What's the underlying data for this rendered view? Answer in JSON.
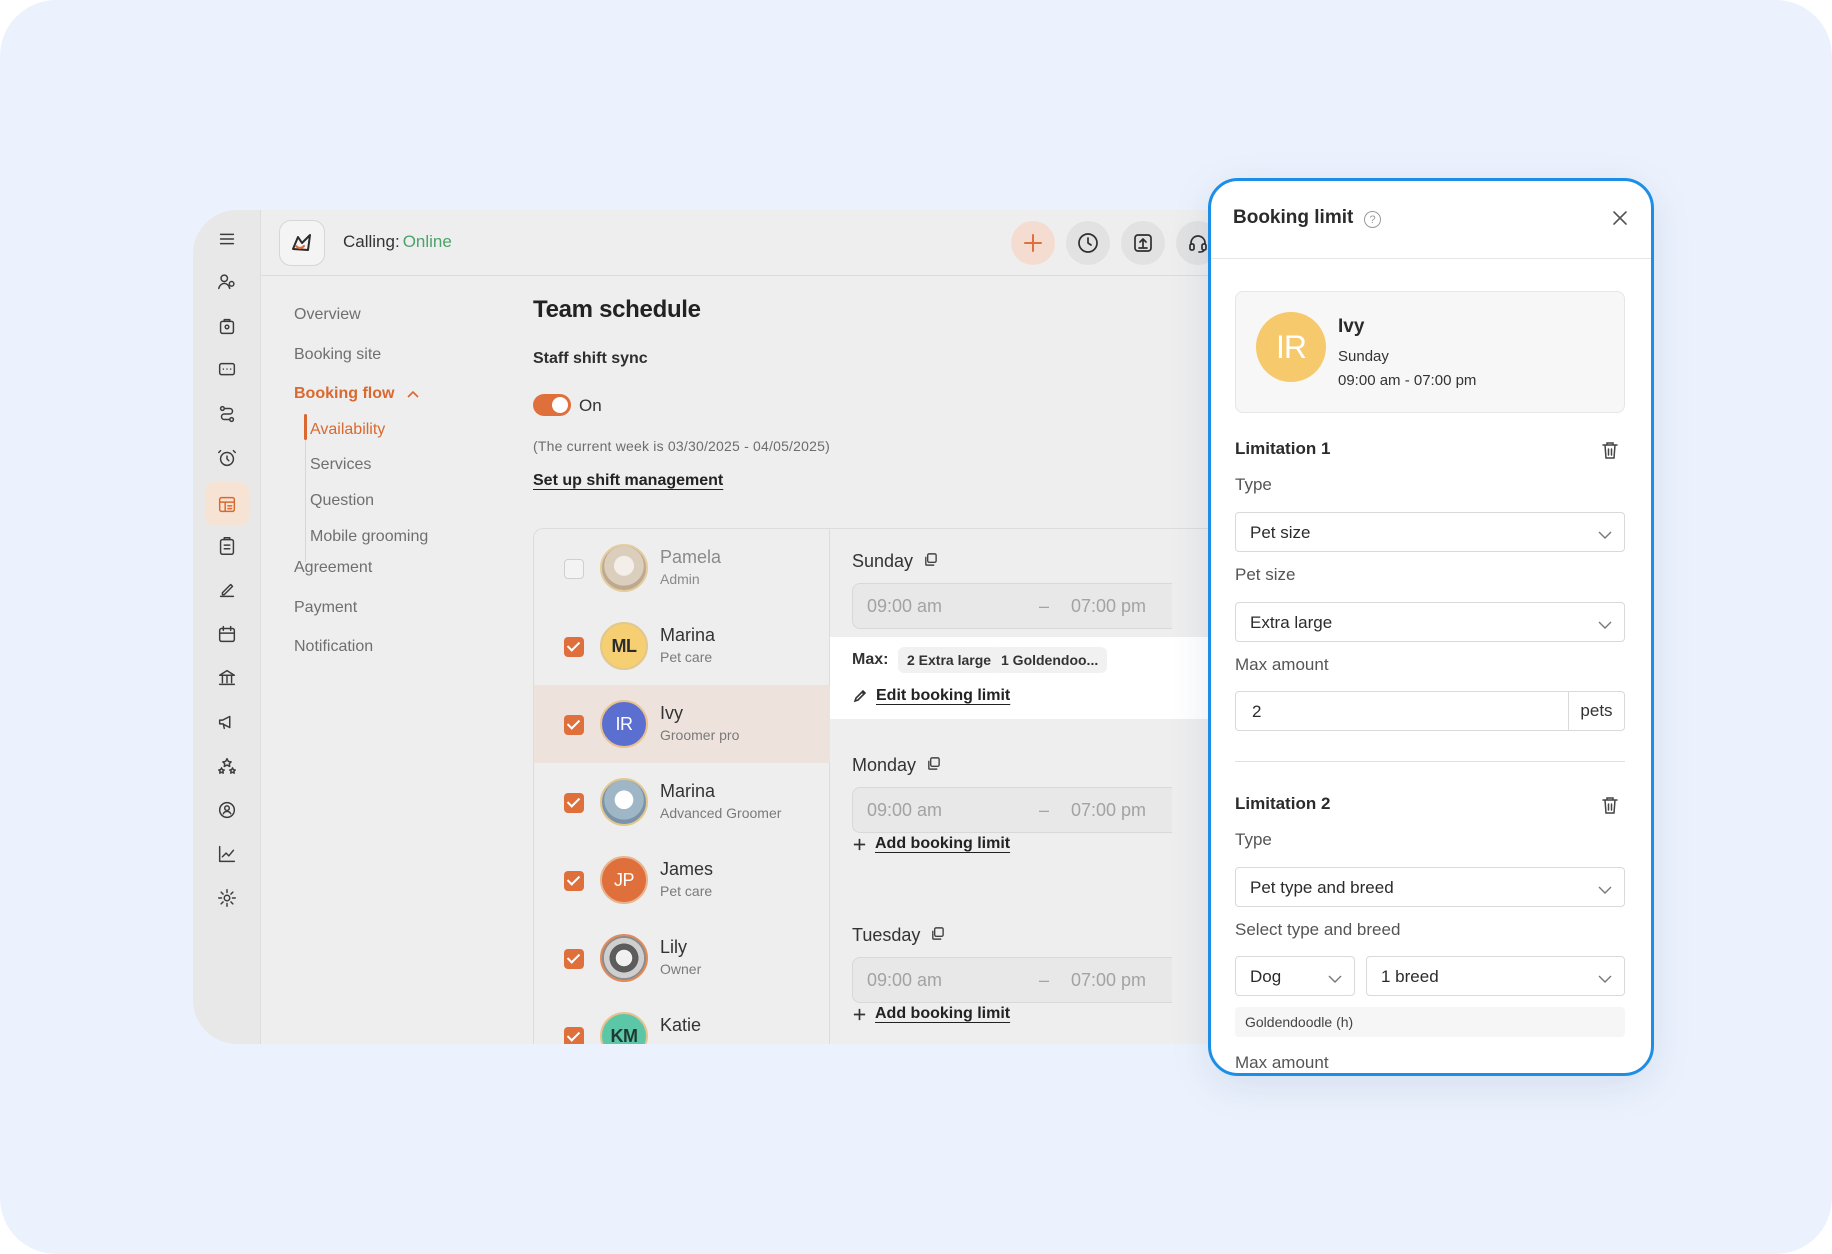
{
  "topbar": {
    "calling_label": "Calling:",
    "calling_status": "Online",
    "colors": {
      "accent": "#e0703b",
      "online": "#4aa36b"
    }
  },
  "subnav": {
    "items": [
      {
        "label": "Overview"
      },
      {
        "label": "Booking site"
      },
      {
        "label": "Booking flow"
      },
      {
        "label": "Agreement"
      },
      {
        "label": "Payment"
      },
      {
        "label": "Notification"
      }
    ],
    "booking_flow_children": [
      {
        "label": "Availability",
        "active": true
      },
      {
        "label": "Services"
      },
      {
        "label": "Question"
      },
      {
        "label": "Mobile grooming"
      }
    ]
  },
  "page": {
    "title": "Team schedule",
    "sync_label": "Staff shift sync",
    "toggle_state": "On",
    "week_note": "(The current week is 03/30/2025 - 04/05/2025)",
    "setup_link": "Set up shift management"
  },
  "staff": [
    {
      "name": "Pamela",
      "role": "Admin",
      "checked": false,
      "avatar": "photo"
    },
    {
      "name": "Marina",
      "role": "Pet care",
      "checked": true,
      "initials": "ML"
    },
    {
      "name": "Ivy",
      "role": "Groomer pro",
      "checked": true,
      "initials": "IR"
    },
    {
      "name": "Marina",
      "role": "Advanced Groomer",
      "checked": true,
      "avatar": "photo"
    },
    {
      "name": "James",
      "role": "Pet care",
      "checked": true,
      "initials": "JP"
    },
    {
      "name": "Lily",
      "role": "Owner",
      "checked": true,
      "avatar": "photo"
    },
    {
      "name": "Katie",
      "role": "",
      "checked": true,
      "initials": "KM"
    }
  ],
  "days": [
    {
      "name": "Sunday",
      "start": "09:00 am",
      "dash": "–",
      "end": "07:00 pm",
      "max_label": "Max:",
      "chips": [
        "2 Extra large",
        "1 Goldendoo..."
      ],
      "link": "Edit booking limit"
    },
    {
      "name": "Monday",
      "start": "09:00 am",
      "dash": "–",
      "end": "07:00 pm",
      "link": "Add booking limit"
    },
    {
      "name": "Tuesday",
      "start": "09:00 am",
      "dash": "–",
      "end": "07:00 pm",
      "link": "Add booking limit"
    }
  ],
  "drawer": {
    "title": "Booking limit",
    "help": "?",
    "staff_card": {
      "initials": "IR",
      "name": "Ivy",
      "day": "Sunday",
      "time": "09:00 am - 07:00 pm"
    },
    "limitation1": {
      "title": "Limitation 1",
      "type_label": "Type",
      "type_value": "Pet size",
      "size_label": "Pet size",
      "size_value": "Extra large",
      "max_label": "Max amount",
      "max_value": "2",
      "max_unit": "pets"
    },
    "limitation2": {
      "title": "Limitation 2",
      "type_label": "Type",
      "type_value": "Pet type and breed",
      "select_label": "Select type and breed",
      "pet_type": "Dog",
      "breed_value": "1 breed",
      "breed_tag": "Goldendoodle (h)",
      "max_label": "Max amount"
    },
    "colors": {
      "frame": "#1c8ee6",
      "avatar": "#f6c96c"
    }
  }
}
